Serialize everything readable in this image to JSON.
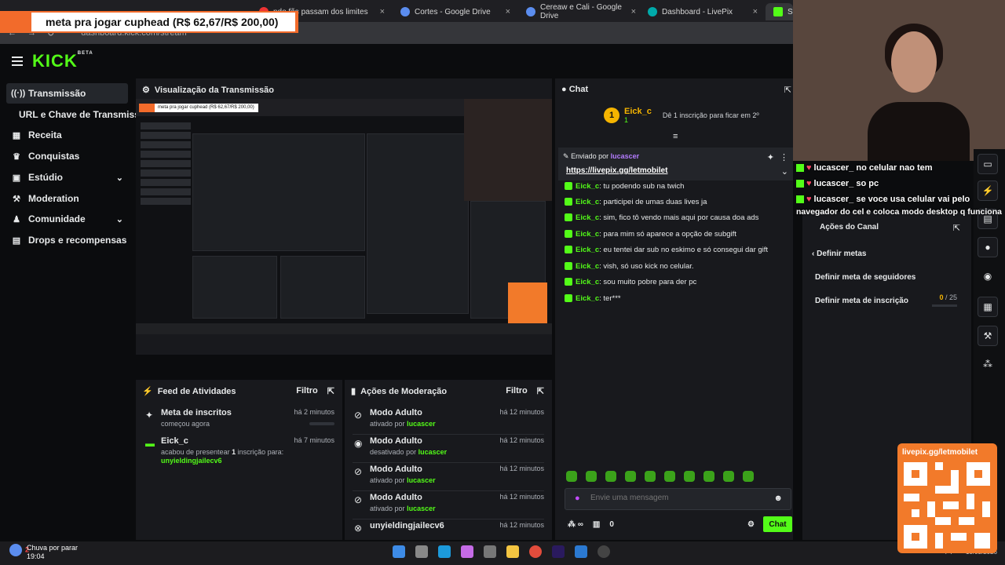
{
  "browser": {
    "tabs": [
      {
        "title": "",
        "active": false
      },
      {
        "title": "",
        "active": false
      },
      {
        "title": "ndo fãs passam dos limites",
        "active": false
      },
      {
        "title": "Cortes - Google Drive",
        "active": false
      },
      {
        "title": "Cereaw e Cali - Google Drive",
        "active": false
      },
      {
        "title": "Dashboard - LivePix",
        "active": false
      },
      {
        "title": "Stre",
        "active": true
      }
    ],
    "close_glyph": "×",
    "url": "dashboard.kick.com/stream"
  },
  "overlay_goal": "meta pra jogar cuphead (R$ 62,67/R$ 200,00)",
  "app": {
    "logo": "KICK",
    "logo_sup": "BETA"
  },
  "sidebar": {
    "items": [
      {
        "label": "Transmissão",
        "icon": "broadcast-icon"
      },
      {
        "label": "Receita",
        "icon": "revenue-icon"
      },
      {
        "label": "Conquistas",
        "icon": "trophy-icon"
      },
      {
        "label": "Estúdio",
        "icon": "studio-icon"
      },
      {
        "label": "Moderation",
        "icon": "wrench-icon"
      },
      {
        "label": "Comunidade",
        "icon": "community-icon"
      },
      {
        "label": "Drops e recompensas",
        "icon": "drops-icon"
      }
    ],
    "sub_item": "URL e Chave de Transmissão"
  },
  "preview": {
    "title": "Visualização da Transmissão",
    "mini_goal": "meta pra jogar cuphead (R$ 62,67/R$ 200,00)"
  },
  "feed": {
    "title": "Feed de Atividades",
    "filter": "Filtro",
    "rows": [
      {
        "title": "Meta de inscritos",
        "desc": "começou agora",
        "time": "há 2 minutos"
      },
      {
        "title": "Eick_c",
        "desc": "acabou de presentear",
        "count": "1",
        "desc2": "inscrição para:",
        "target": "unyieldingjailecv6",
        "time": "há 7 minutos"
      }
    ]
  },
  "moderation": {
    "title": "Ações de Moderação",
    "filter": "Filtro",
    "by_word": "por",
    "rows": [
      {
        "title": "Modo Adulto",
        "action": "ativado",
        "user": "lucascer",
        "time": "há 12 minutos"
      },
      {
        "title": "Modo Adulto",
        "action": "desativado",
        "user": "lucascer",
        "time": "há 12 minutos"
      },
      {
        "title": "Modo Adulto",
        "action": "ativado",
        "user": "lucascer",
        "time": "há 12 minutos"
      },
      {
        "title": "Modo Adulto",
        "action": "ativado",
        "user": "lucascer",
        "time": "há 12 minutos"
      },
      {
        "title": "unyieldingjailecv6",
        "action": "",
        "user": "",
        "time": "há 12 minutos"
      }
    ]
  },
  "chat": {
    "title": "Chat",
    "top_gifter": {
      "rank": "1",
      "name": "Eick_c",
      "subs": "1"
    },
    "top_info": "Dê 1 inscrição para ficar em 2º",
    "pinned_by": "Enviado por",
    "pinned_user": "lucascer",
    "pinned_link": "https://livepix.gg/letmobilet",
    "messages": [
      {
        "user": "Eick_c",
        "text": "tu podendo sub na twich"
      },
      {
        "user": "Eick_c",
        "text": "participei de umas duas lives ja"
      },
      {
        "user": "Eick_c",
        "text": "sim, fico tô vendo mais aqui por causa doa ads"
      },
      {
        "user": "Eick_c",
        "text": "para mim só aparece a opção de subgift"
      },
      {
        "user": "Eick_c",
        "text": "eu tentei dar sub no eskimo e só consegui dar gift"
      },
      {
        "user": "Eick_c",
        "text": "vish, só uso kick no celular."
      },
      {
        "user": "Eick_c",
        "text": "sou muito pobre para der pc"
      },
      {
        "user": "Eick_c",
        "text": "ter***"
      }
    ],
    "input_placeholder": "Envie uma mensagem",
    "points": "0",
    "send_label": "Chat"
  },
  "stream_overlay_chat": [
    {
      "user": "lucascer_",
      "text": "no celular nao tem"
    },
    {
      "user": "lucascer_",
      "text": "so pc"
    },
    {
      "user": "lucascer_",
      "text": "se voce usa celular vai pelo"
    },
    {
      "user": "",
      "text": "navegador do cel e coloca modo desktop q funciona"
    }
  ],
  "channel_actions": {
    "title": "Ações do Canal",
    "section": "Definir metas",
    "rows": [
      "Definir meta de seguidores",
      "Definir meta de inscrição"
    ],
    "sub_goal_current": "0",
    "sub_goal_target": "/ 25"
  },
  "qr": {
    "label": "livepix.gg/letmobilet"
  },
  "taskbar": {
    "weather": "Chuva por parar",
    "weather_badge": "2",
    "time": "19:04",
    "lang": "PT",
    "date": "10/03/2026"
  }
}
